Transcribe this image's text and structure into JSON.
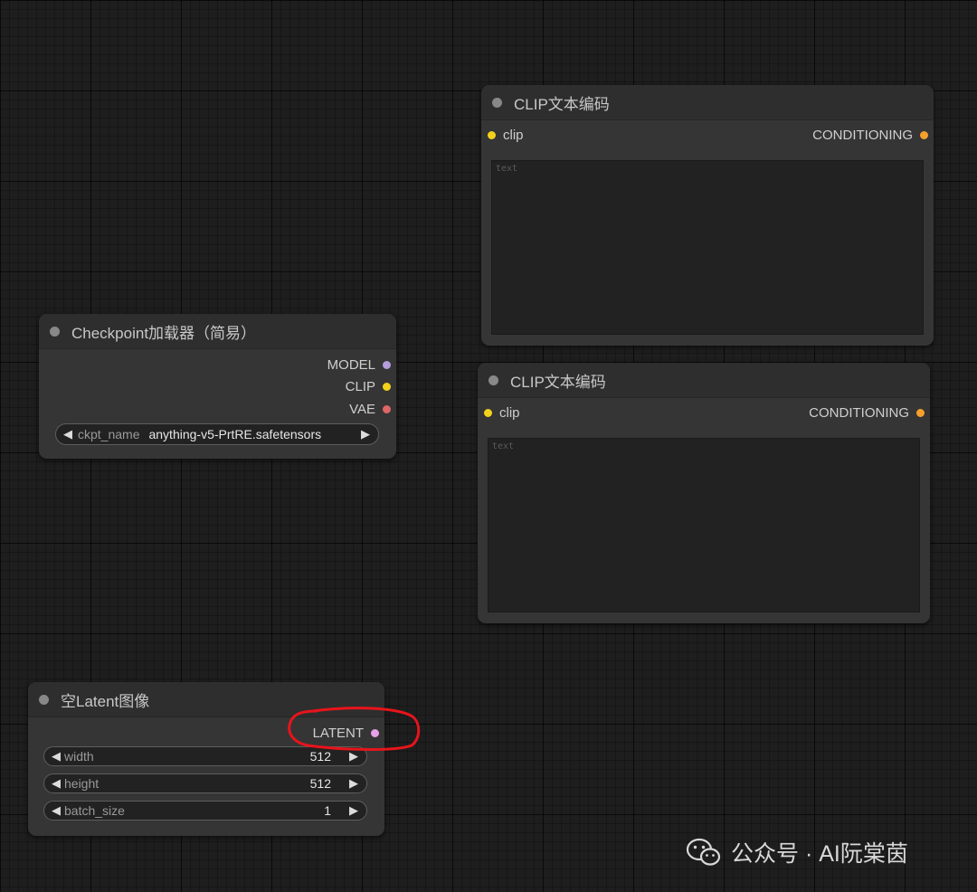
{
  "clip_node_1": {
    "title": "CLIP文本编码",
    "input": "clip",
    "output": "CONDITIONING",
    "placeholder": "text"
  },
  "clip_node_2": {
    "title": "CLIP文本编码",
    "input": "clip",
    "output": "CONDITIONING",
    "placeholder": "text"
  },
  "checkpoint_node": {
    "title": "Checkpoint加载器（简易）",
    "outputs": [
      "MODEL",
      "CLIP",
      "VAE"
    ],
    "widget_label": "ckpt_name",
    "widget_value": "anything-v5-PrtRE.safetensors"
  },
  "latent_node": {
    "title": "空Latent图像",
    "output": "LATENT",
    "widgets": [
      {
        "label": "width",
        "value": "512"
      },
      {
        "label": "height",
        "value": "512"
      },
      {
        "label": "batch_size",
        "value": "1"
      }
    ]
  },
  "watermark": "公众号 · AI阮棠茵",
  "colors": {
    "clip_slot": "#f2d21b",
    "conditioning_slot": "#f5a02c",
    "model_slot": "#b39ddb",
    "vae_slot": "#e06666",
    "latent_slot": "#e8a0e8",
    "annotation_circle": "#e8141b",
    "node_bg": "#353535",
    "canvas_bg": "#1e1e1e"
  }
}
